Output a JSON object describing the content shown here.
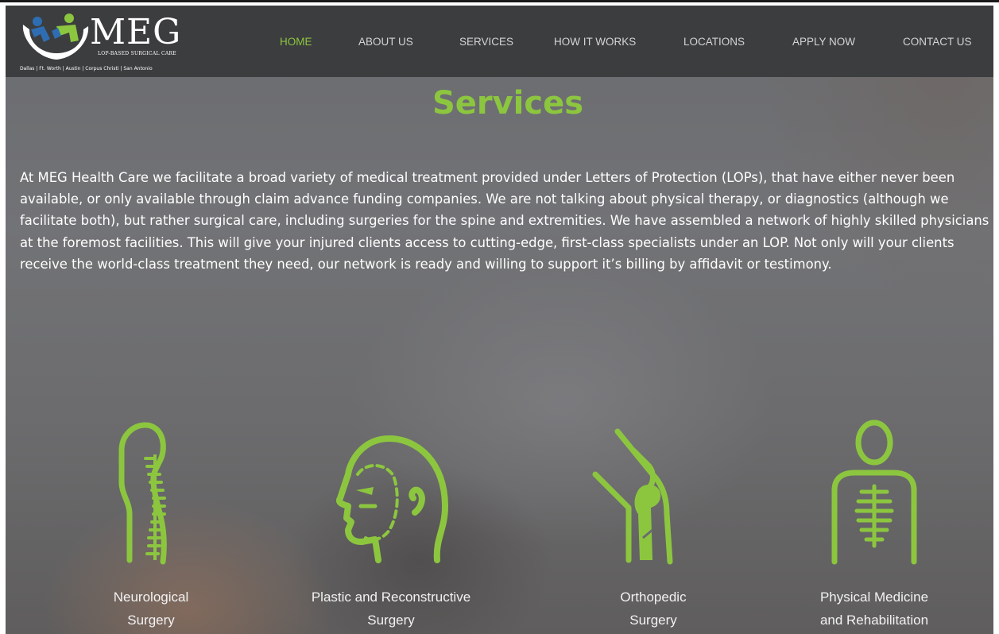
{
  "brand": {
    "name": "MEG",
    "tagline": "LOP-BASED SURGICAL CARE",
    "cities": "Dallas | Ft. Worth | Austin | Corpus Christi | San Antonio"
  },
  "nav": {
    "items": [
      {
        "label": "HOME",
        "active": true
      },
      {
        "label": "ABOUT US",
        "active": false
      },
      {
        "label": "SERVICES",
        "active": false
      },
      {
        "label": "HOW IT WORKS",
        "active": false
      },
      {
        "label": "LOCATIONS",
        "active": false
      },
      {
        "label": "APPLY NOW",
        "active": false
      },
      {
        "label": "CONTACT US",
        "active": false
      }
    ]
  },
  "page": {
    "title": "Services",
    "intro": "At MEG Health Care we facilitate a broad variety of medical treatment provided under Letters of Protection (LOPs), that have either never been available, or only available through claim advance funding companies. We are not talking about physical therapy, or diagnostics (although we facilitate both), but rather surgical care, including surgeries for the spine and extremities. We have assembled a network of highly skilled physicians at the foremost facilities. This will give your injured clients access to cutting-edge, first-class specialists under an LOP. Not only will your clients receive the world-class treatment they need, our network is ready and willing to support it’s billing by affidavit or testimony."
  },
  "services": [
    {
      "line1": "Neurological",
      "line2": "Surgery",
      "icon": "spine-icon"
    },
    {
      "line1": "Plastic and Reconstructive",
      "line2": "Surgery",
      "icon": "face-profile-icon"
    },
    {
      "line1": "Orthopedic",
      "line2": "Surgery",
      "icon": "knee-joint-icon"
    },
    {
      "line1": "Physical Medicine",
      "line2": "and Rehabilitation",
      "icon": "body-ribcage-icon"
    }
  ],
  "colors": {
    "accent": "#8cc63f",
    "header_bg": "#3c3d3f",
    "text": "#ffffff"
  }
}
